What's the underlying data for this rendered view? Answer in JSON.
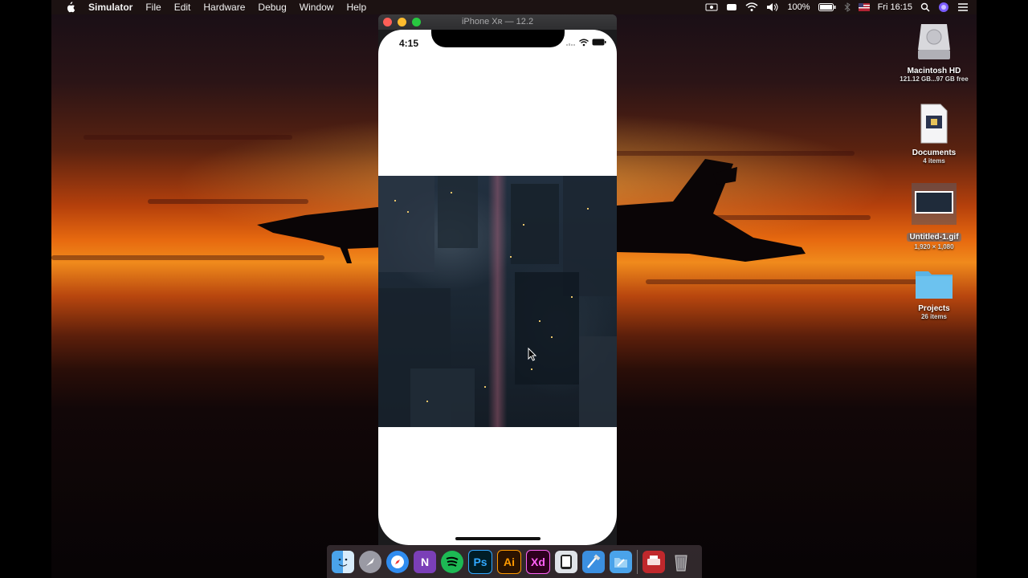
{
  "menubar": {
    "app_name": "Simulator",
    "menus": [
      "File",
      "Edit",
      "Hardware",
      "Debug",
      "Window",
      "Help"
    ],
    "battery": "100%",
    "clock": "Fri 16:15"
  },
  "simulator": {
    "title": "iPhone Xʀ — 12.2",
    "status_time": "4:15"
  },
  "desktop_icons": [
    {
      "name": "Macintosh HD",
      "sub": "121.12 GB...97 GB free"
    },
    {
      "name": "Documents",
      "sub": "4 items"
    },
    {
      "name": "Untitled-1.gif",
      "sub": "1,920 × 1,080"
    },
    {
      "name": "Projects",
      "sub": "26 items"
    }
  ],
  "dock": {
    "items": [
      "Finder",
      "Launchpad",
      "Safari",
      "OneNote",
      "Spotify",
      "Photoshop",
      "Illustrator",
      "Adobe XD",
      "Simulator",
      "Xcode",
      "Xcode Folder",
      "Printer",
      "Trash"
    ],
    "ps_label": "Ps",
    "ai_label": "Ai",
    "xd_label": "Xd",
    "n_label": "N"
  },
  "colors": {
    "spotify": "#1db954",
    "ps": "#31a8ff",
    "ai": "#ff9a00",
    "xd": "#ff61f6"
  }
}
